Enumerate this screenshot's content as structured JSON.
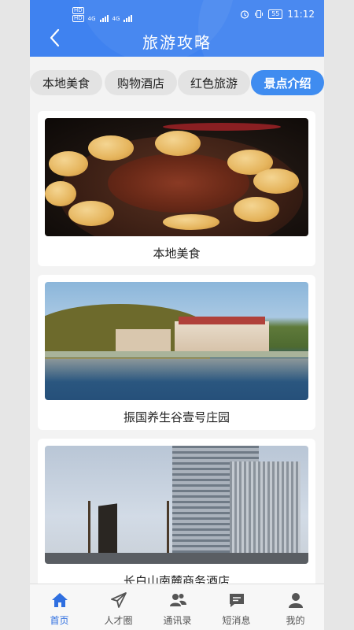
{
  "status_bar": {
    "left_badges": [
      "HD",
      "HD"
    ],
    "network": [
      "4G",
      "4G"
    ],
    "battery": "55",
    "time": "11:12"
  },
  "header": {
    "title": "旅游攻略",
    "back_icon": "chevron-left-icon",
    "color": "#3f82f0"
  },
  "tabs": [
    {
      "label": "本地美食",
      "active": false
    },
    {
      "label": "购物酒店",
      "active": false
    },
    {
      "label": "红色旅游",
      "active": false
    },
    {
      "label": "景点介绍",
      "active": true
    }
  ],
  "cards": [
    {
      "caption": "本地美食"
    },
    {
      "caption": "振国养生谷壹号庄园"
    },
    {
      "caption": "长白山南麓商务酒店"
    }
  ],
  "bottom_nav": [
    {
      "label": "首页",
      "icon": "home-icon",
      "active": true
    },
    {
      "label": "人才圈",
      "icon": "paper-plane-icon",
      "active": false
    },
    {
      "label": "通讯录",
      "icon": "contacts-icon",
      "active": false
    },
    {
      "label": "短消息",
      "icon": "message-icon",
      "active": false
    },
    {
      "label": "我的",
      "icon": "user-icon",
      "active": false
    }
  ],
  "accent_color": "#2f6fe0"
}
